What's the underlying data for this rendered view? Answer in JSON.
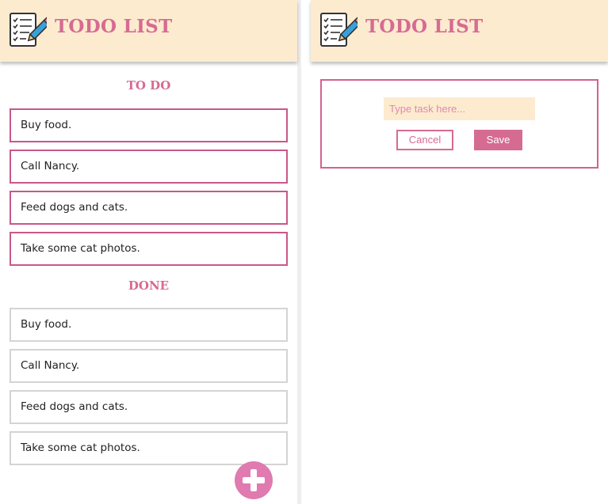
{
  "app": {
    "title": "TODO LIST"
  },
  "list_view": {
    "todo_heading": "TO DO",
    "todo_items": [
      "Buy food.",
      "Call Nancy.",
      "Feed dogs and cats.",
      "Take some cat photos."
    ],
    "done_heading": "DONE",
    "done_items": [
      "Buy food.",
      "Call Nancy.",
      "Feed dogs and cats.",
      "Take some cat photos."
    ]
  },
  "editor_view": {
    "input_placeholder": "Type task here...",
    "input_value": "",
    "cancel_label": "Cancel",
    "save_label": "Save"
  },
  "icons": {
    "logo": "checklist-pencil-icon",
    "fab": "plus-icon"
  },
  "colors": {
    "accent": "#d66b92",
    "header_bg": "#fdebd0",
    "done_border": "#d4d4d4"
  }
}
